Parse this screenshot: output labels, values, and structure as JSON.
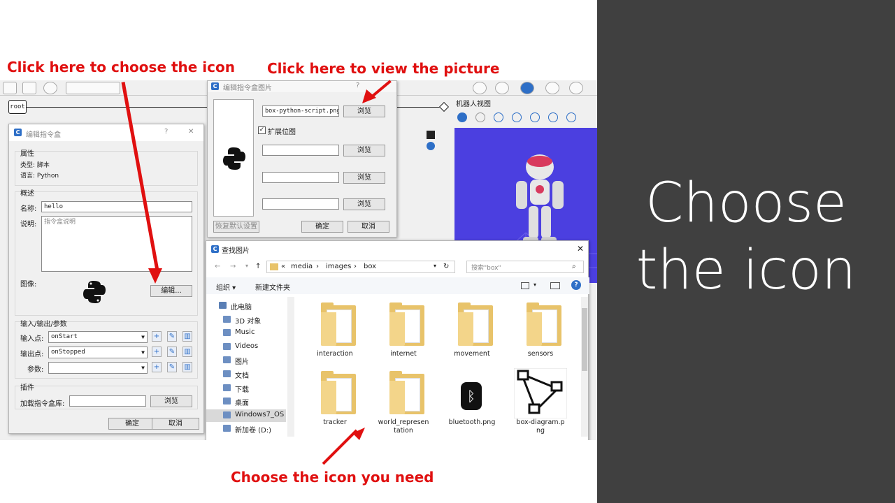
{
  "annotations": {
    "choose_icon": "Click here to choose the icon",
    "view_picture": "Click here to view the picture",
    "choose_need": "Choose the icon you need"
  },
  "slide_title": {
    "line1": "Choose",
    "line2": "the icon"
  },
  "robot_view": {
    "title": "机器人视图"
  },
  "flow": {
    "root_label": "root"
  },
  "box_dialog": {
    "title": "编辑指令盒",
    "help": "?",
    "close": "✕",
    "props_header": "属性",
    "type_line": "类型: 脚本",
    "lang_line": "语言: Python",
    "overview_header": "概述",
    "name_label": "名称:",
    "name_value": "hello",
    "desc_label": "说明:",
    "desc_placeholder": "指令盒说明",
    "image_label": "图像:",
    "edit_button": "编辑...",
    "io_header": "输入/输出/参数",
    "input_label": "输入点:",
    "input_value": "onStart",
    "output_label": "输出点:",
    "output_value": "onStopped",
    "param_label": "参数:",
    "plugin_header": "插件",
    "load_label": "加载指令盒库:",
    "browse": "浏览",
    "ok": "确定",
    "cancel": "取消"
  },
  "image_dialog": {
    "title": "编辑指令盒图片",
    "help": "?",
    "file_value": "box-python-script.png",
    "browse": "浏览",
    "expand_label": "扩展位图",
    "restore": "恢复默认设置",
    "ok": "确定",
    "cancel": "取消"
  },
  "file_picker": {
    "title": "查找图片",
    "close": "✕",
    "path": [
      "«",
      "media",
      "›",
      "images",
      "›",
      "box"
    ],
    "search_placeholder": "搜索\"box\"",
    "organize": "组织 ▾",
    "new_folder": "新建文件夹",
    "tree": [
      {
        "label": "此电脑",
        "icon": "pc-icon"
      },
      {
        "label": "3D 对象",
        "icon": "cube-icon"
      },
      {
        "label": "Music",
        "icon": "music-icon"
      },
      {
        "label": "Videos",
        "icon": "video-icon"
      },
      {
        "label": "图片",
        "icon": "pictures-icon"
      },
      {
        "label": "文档",
        "icon": "document-icon"
      },
      {
        "label": "下载",
        "icon": "download-icon"
      },
      {
        "label": "桌面",
        "icon": "desktop-icon"
      },
      {
        "label": "Windows7_OS",
        "icon": "drive-icon"
      },
      {
        "label": "新加卷 (D:)",
        "icon": "drive-icon"
      }
    ],
    "files": [
      {
        "name": "interaction",
        "kind": "folder"
      },
      {
        "name": "internet",
        "kind": "folder"
      },
      {
        "name": "movement",
        "kind": "folder"
      },
      {
        "name": "sensors",
        "kind": "folder"
      },
      {
        "name": "tracker",
        "kind": "folder"
      },
      {
        "name": "world_represen",
        "name2": "tation",
        "kind": "folder"
      },
      {
        "name": "bluetooth.png",
        "kind": "image"
      },
      {
        "name": "box-diagram.p",
        "name2": "ng",
        "kind": "image"
      }
    ]
  }
}
